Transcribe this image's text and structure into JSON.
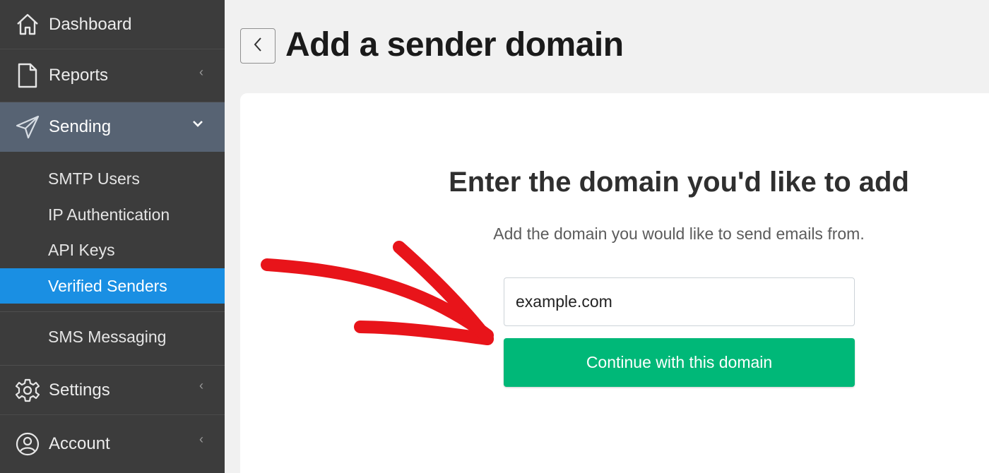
{
  "sidebar": {
    "items": [
      {
        "label": "Dashboard",
        "icon": "home-icon",
        "chevron": ""
      },
      {
        "label": "Reports",
        "icon": "document-icon",
        "chevron": "‹"
      },
      {
        "label": "Sending",
        "icon": "paper-plane-icon",
        "chevron": "⌄"
      },
      {
        "label": "Settings",
        "icon": "gear-icon",
        "chevron": "‹"
      },
      {
        "label": "Account",
        "icon": "user-circle-icon",
        "chevron": "‹"
      }
    ],
    "sending_subitems": [
      {
        "label": "SMTP Users"
      },
      {
        "label": "IP Authentication"
      },
      {
        "label": "API Keys"
      },
      {
        "label": "Verified Senders"
      },
      {
        "label": "SMS Messaging"
      }
    ],
    "active_item": "Sending",
    "selected_subitem": "Verified Senders"
  },
  "header": {
    "back_icon": "chevron-left-icon",
    "title": "Add a sender domain"
  },
  "main": {
    "heading": "Enter the domain you'd like to add",
    "subheading": "Add the domain you would like to send emails from.",
    "domain_input": {
      "value": "example.com",
      "placeholder": ""
    },
    "continue_label": "Continue with this domain"
  },
  "colors": {
    "sidebar_bg": "#3c3c3c",
    "active_bg": "#576373",
    "selected_bg": "#1a8fe3",
    "button_bg": "#00b878",
    "annotation_arrow": "#e8141a"
  }
}
